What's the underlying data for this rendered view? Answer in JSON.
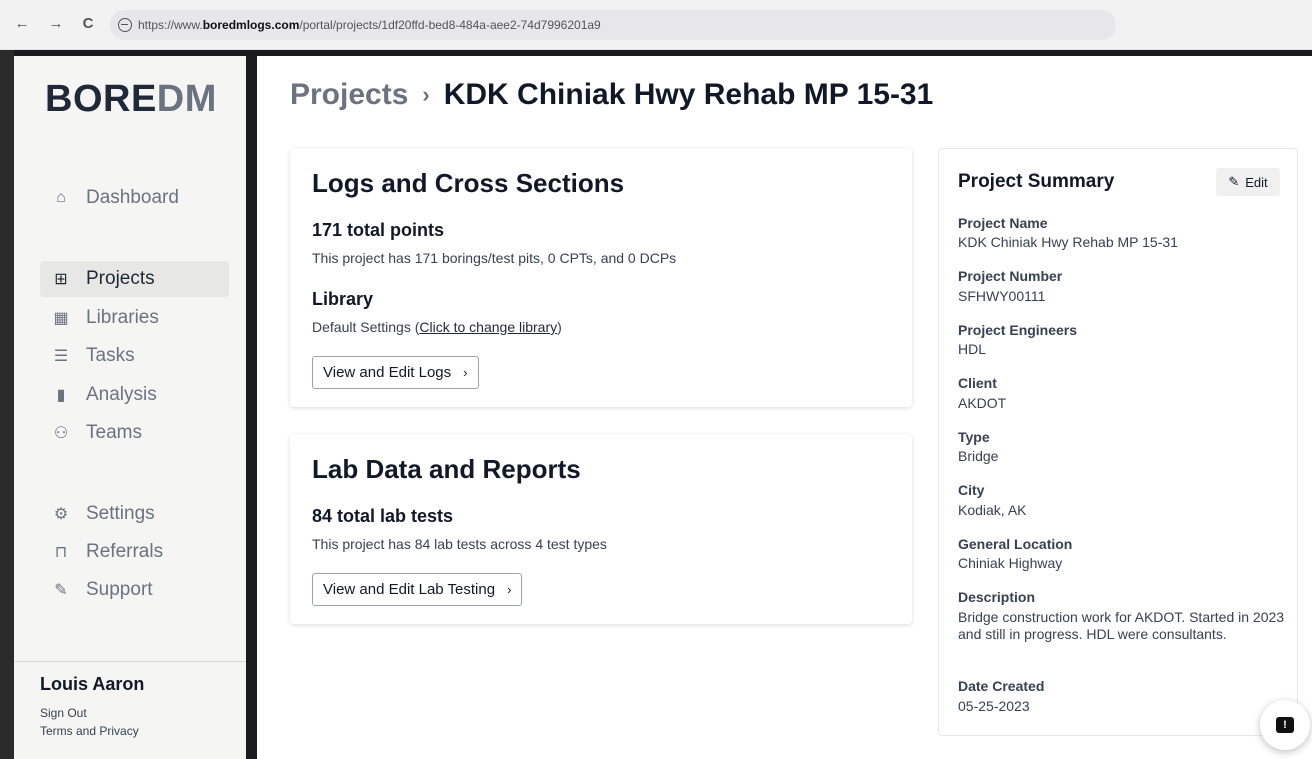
{
  "browser": {
    "back": "←",
    "forward": "→",
    "reload": "C",
    "url_prefix": "https://www.",
    "url_domain": "boredmlogs.com",
    "url_path": "/portal/projects/1df20ffd-bed8-484a-aee2-74d7996201a9"
  },
  "sidebar": {
    "logo_bore": "BORE",
    "logo_dm": "DM",
    "items": [
      {
        "label": "Dashboard",
        "icon": "home-icon",
        "glyph": "⌂"
      },
      {
        "label": "Projects",
        "icon": "projects-icon",
        "glyph": "⊞"
      },
      {
        "label": "Libraries",
        "icon": "libraries-icon",
        "glyph": "▦"
      },
      {
        "label": "Tasks",
        "icon": "tasks-icon",
        "glyph": "☰"
      },
      {
        "label": "Analysis",
        "icon": "analysis-icon",
        "glyph": "▮"
      },
      {
        "label": "Teams",
        "icon": "teams-icon",
        "glyph": "⚇"
      },
      {
        "label": "Settings",
        "icon": "gear-icon",
        "glyph": "⚙"
      },
      {
        "label": "Referrals",
        "icon": "gift-icon",
        "glyph": "⊓"
      },
      {
        "label": "Support",
        "icon": "wrench-icon",
        "glyph": "✎"
      }
    ],
    "active_item": "Projects",
    "user_name": "Louis Aaron",
    "sign_out": "Sign Out",
    "terms": "Terms and Privacy"
  },
  "breadcrumb": {
    "root": "Projects",
    "separator": "›",
    "current": "KDK Chiniak Hwy Rehab MP 15-31"
  },
  "logs_card": {
    "title": "Logs and Cross Sections",
    "points_heading": "171 total points",
    "points_desc": "This project has 171 borings/test pits, 0 CPTs, and 0 DCPs",
    "library_heading": "Library",
    "library_desc_prefix": "Default Settings (",
    "library_link": "Click to change library",
    "library_desc_suffix": ")",
    "button_label": "View and Edit Logs"
  },
  "lab_card": {
    "title": "Lab Data and Reports",
    "tests_heading": "84 total lab tests",
    "tests_desc": "This project has 84 lab tests across 4 test types",
    "button_label": "View and Edit Lab Testing"
  },
  "summary": {
    "title": "Project Summary",
    "edit_label": "Edit",
    "fields": [
      {
        "label": "Project Name",
        "value": "KDK Chiniak Hwy Rehab MP 15-31"
      },
      {
        "label": "Project Number",
        "value": "SFHWY00111"
      },
      {
        "label": "Project Engineers",
        "value": "HDL"
      },
      {
        "label": "Client",
        "value": "AKDOT"
      },
      {
        "label": "Type",
        "value": "Bridge"
      },
      {
        "label": "City",
        "value": "Kodiak, AK"
      },
      {
        "label": "General Location",
        "value": "Chiniak Highway"
      },
      {
        "label": "Description",
        "value": "Bridge construction work for AKDOT. Started in 2023 and still in progress. HDL were consultants."
      },
      {
        "label": "Date Created",
        "value": "05-25-2023"
      }
    ]
  },
  "chat": {
    "glyph": "!"
  },
  "chevron": "›"
}
